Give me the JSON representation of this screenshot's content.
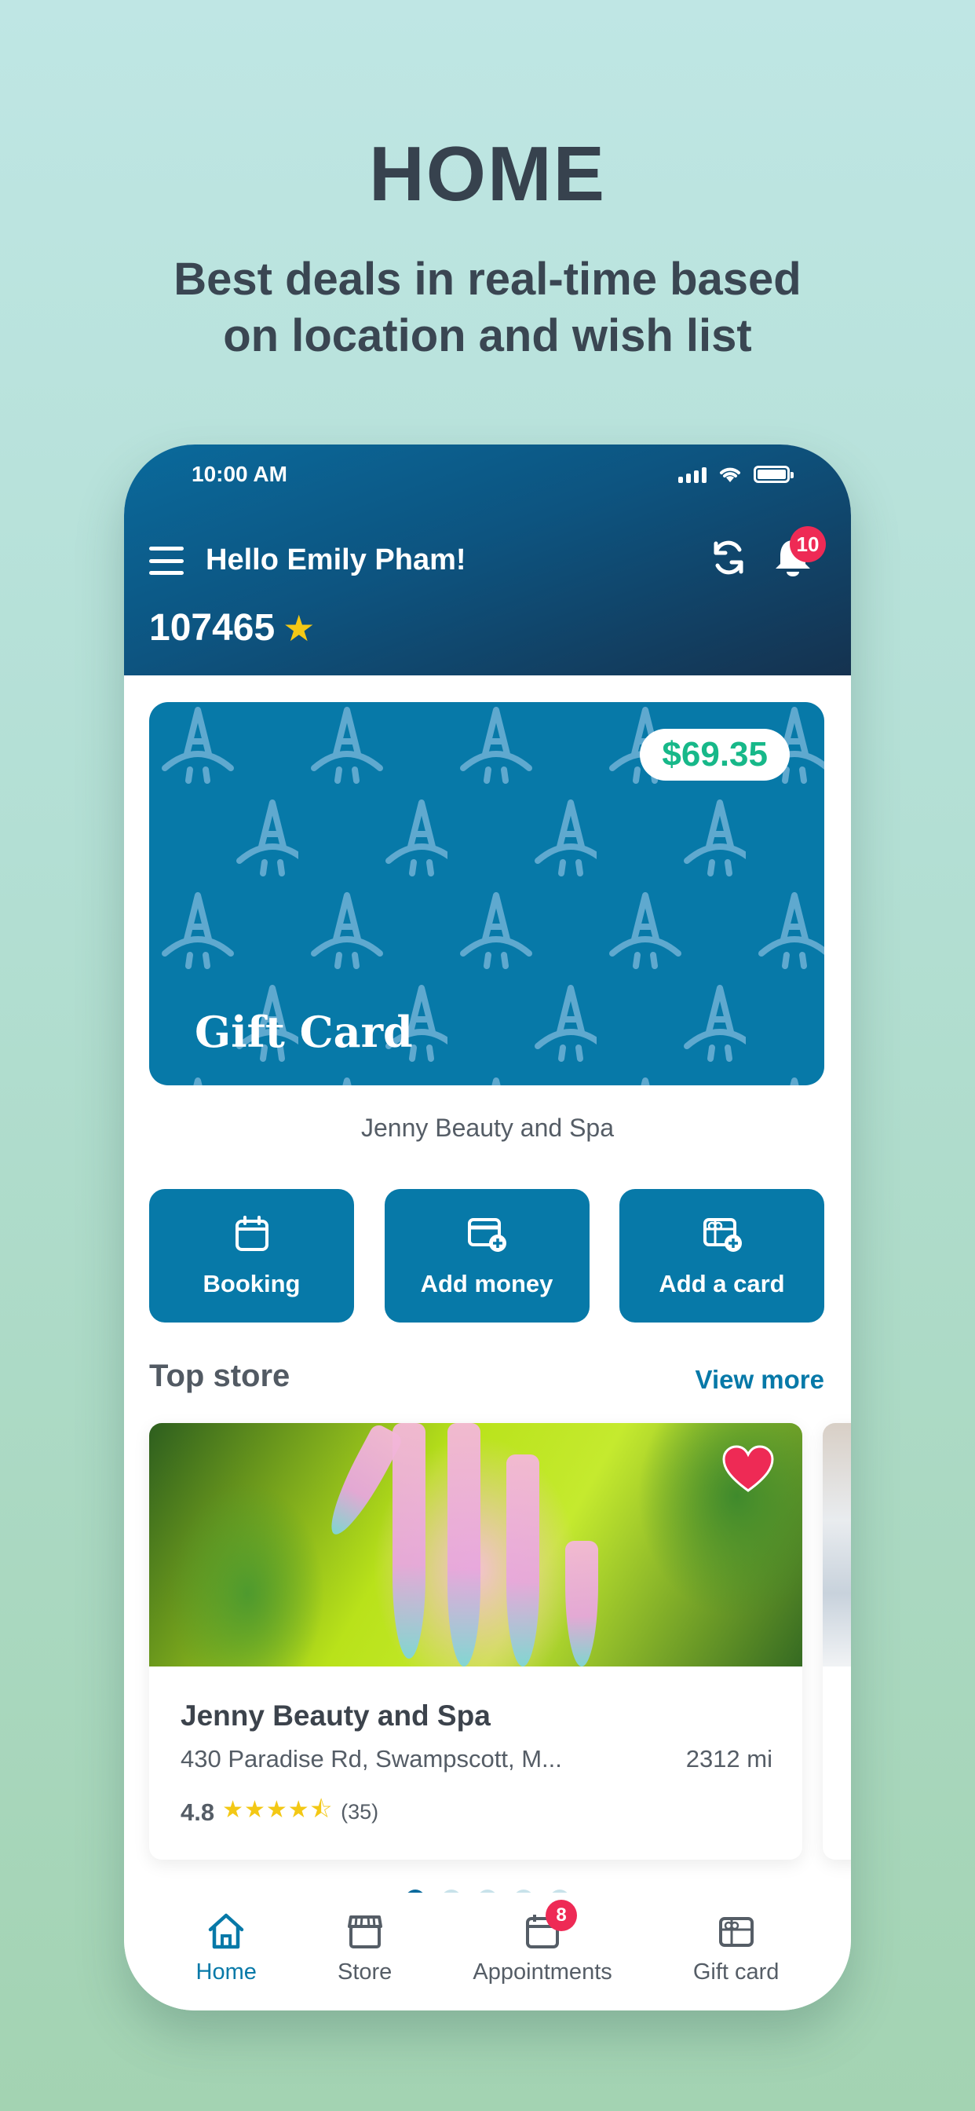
{
  "promo": {
    "title": "HOME",
    "subtitle_line1": "Best deals in real-time based",
    "subtitle_line2": "on location and wish list"
  },
  "status_bar": {
    "time": "10:00 AM",
    "icons": [
      "signal-icon",
      "wifi-icon",
      "battery-icon"
    ]
  },
  "header": {
    "menu_icon": "hamburger-menu-icon",
    "greeting": "Hello Emily Pham!",
    "points": "107465",
    "points_icon": "star-icon",
    "refresh_icon": "refresh-icon",
    "notification_icon": "bell-icon",
    "notification_count": "10"
  },
  "gift_card": {
    "balance": "$69.35",
    "label": "Gift Card",
    "store_name": "Jenny Beauty and Spa"
  },
  "actions": [
    {
      "label": "Booking",
      "icon": "calendar-icon"
    },
    {
      "label": "Add money",
      "icon": "card-add-icon"
    },
    {
      "label": "Add a card",
      "icon": "gift-card-add-icon"
    }
  ],
  "top_store": {
    "title": "Top store",
    "view_more": "View more",
    "stores": [
      {
        "name": "Jenny Beauty and Spa",
        "address": "430 Paradise Rd, Swampscott, M...",
        "distance": "2312 mi",
        "rating": "4.8",
        "stars": "★★★★⯪",
        "reviews": "(35)",
        "favorite": true
      }
    ],
    "carousel_pages": 5,
    "carousel_active": 1
  },
  "bottom_nav": [
    {
      "label": "Home",
      "icon": "home-icon",
      "active": true
    },
    {
      "label": "Store",
      "icon": "store-icon",
      "active": false
    },
    {
      "label": "Appointments",
      "icon": "calendar-icon",
      "active": false,
      "badge": "8"
    },
    {
      "label": "Gift card",
      "icon": "gift-card-icon",
      "active": false
    }
  ],
  "colors": {
    "primary": "#0779a8",
    "header_dark": "#15324f",
    "badge": "#ee2a55",
    "balance": "#17b889",
    "star": "#f3c815"
  }
}
